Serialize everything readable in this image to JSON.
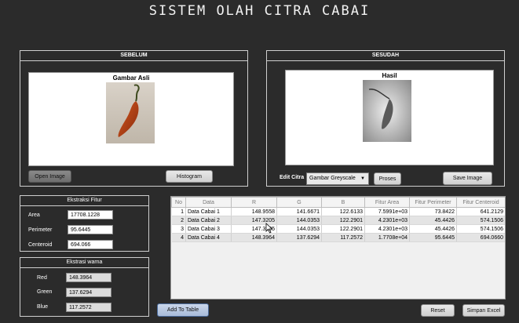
{
  "app": {
    "title": "SISTEM OLAH CITRA CABAI"
  },
  "before_panel": {
    "header": "SEBELUM",
    "image_caption": "Gambar Asli",
    "open_label": "Open Image",
    "histogram_label": "Histogram"
  },
  "after_panel": {
    "header": "SESUDAH",
    "image_caption": "Hasil",
    "edit_label": "Edit Citra",
    "edit_option": "Gambar Greyscale",
    "process_label": "Proses",
    "save_label": "Save Image"
  },
  "features": {
    "header": "Ekstraksi Fitur",
    "area_label": "Area",
    "area_value": "17708.1228",
    "perimeter_label": "Perimeter",
    "perimeter_value": "95.6445",
    "centroid_label": "Centeroid",
    "centroid_value": "694.066"
  },
  "colors": {
    "header": "Ekstrasi warna",
    "red_label": "Red",
    "red_value": "148.3964",
    "green_label": "Green",
    "green_value": "137.6294",
    "blue_label": "Blue",
    "blue_value": "117.2572"
  },
  "table": {
    "columns": [
      "No",
      "Data",
      "R",
      "G",
      "B",
      "Fitur Area",
      "Fitur Perimeter",
      "Fitur Centeroid"
    ],
    "rows": [
      [
        "1",
        "Data Cabai 1",
        "148.9558",
        "141.6671",
        "122.6133",
        "7.5991e+03",
        "73.8422",
        "641.2129"
      ],
      [
        "2",
        "Data Cabai 2",
        "147.3205",
        "144.0353",
        "122.2901",
        "4.2301e+03",
        "45.4426",
        "574.1506"
      ],
      [
        "3",
        "Data Cabai 3",
        "147.3205",
        "144.0353",
        "122.2901",
        "4.2301e+03",
        "45.4426",
        "574.1506"
      ],
      [
        "4",
        "Data Cabai 4",
        "148.3964",
        "137.6294",
        "117.2572",
        "1.7708e+04",
        "95.6445",
        "694.0660"
      ]
    ]
  },
  "buttons": {
    "add_to_table": "Add To Table",
    "reset": "Reset",
    "save_excel": "Simpan Excel"
  }
}
